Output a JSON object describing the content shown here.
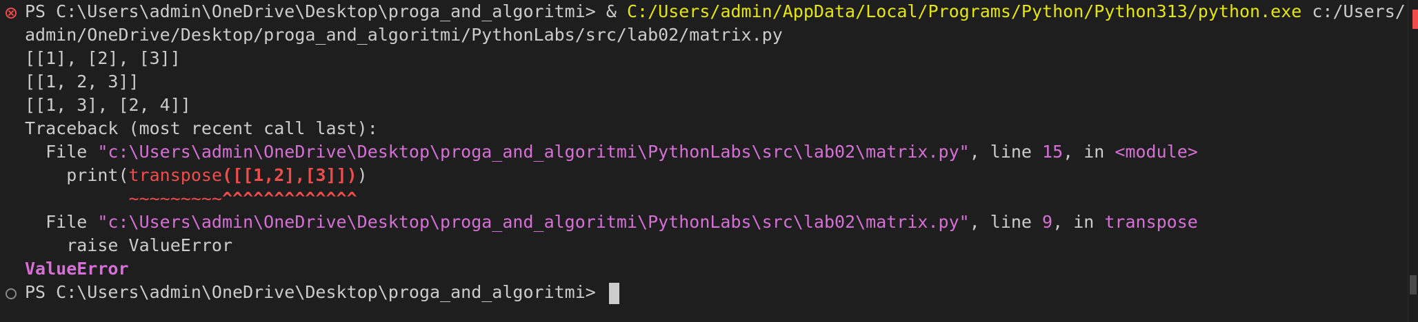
{
  "terminal": {
    "colors": {
      "background": "#1e1e1e",
      "text": "#cccccc",
      "error": "#f14c4c",
      "path_highlight": "#e5e510",
      "magenta": "#d670d6"
    },
    "gutter_icons": [
      "error-circle-icon",
      "idle-circle-icon"
    ],
    "line1": {
      "prompt": "PS C:\\Users\\admin\\OneDrive\\Desktop\\proga_and_algoritmi> ",
      "amp": "& ",
      "exe": "C:/Users/admin/AppData/Local/Programs/Python/Python313/python.exe",
      "arg_start": " c:/Users/"
    },
    "line2": "admin/OneDrive/Desktop/proga_and_algoritmi/PythonLabs/src/lab02/matrix.py",
    "output1": "[[1], [2], [3]]",
    "output2": "[[1, 2, 3]]",
    "output3": "[[1, 3], [2, 4]]",
    "traceback_header": "Traceback (most recent call last):",
    "frame1": {
      "prefix": "  File ",
      "file": "\"c:\\Users\\admin\\OneDrive\\Desktop\\proga_and_algoritmi\\PythonLabs\\src\\lab02\\matrix.py\"",
      "mid": ", line ",
      "lineno": "15",
      "in_text": ", in ",
      "func": "<module>"
    },
    "code1": {
      "indent": "    ",
      "call_start": "print(",
      "func_name": "transpose",
      "args": "([[1,2],[3]])",
      "close": ")"
    },
    "markers": {
      "indent": "          ",
      "tildes": "~~~~~~~~~",
      "carets": "^^^^^^^^^^^^^"
    },
    "frame2": {
      "prefix": "  File ",
      "file": "\"c:\\Users\\admin\\OneDrive\\Desktop\\proga_and_algoritmi\\PythonLabs\\src\\lab02\\matrix.py\"",
      "mid": ", line ",
      "lineno": "9",
      "in_text": ", in ",
      "func": "transpose"
    },
    "code2": "    raise ValueError",
    "exception": "ValueError",
    "final_prompt": "PS C:\\Users\\admin\\OneDrive\\Desktop\\proga_and_algoritmi> "
  }
}
